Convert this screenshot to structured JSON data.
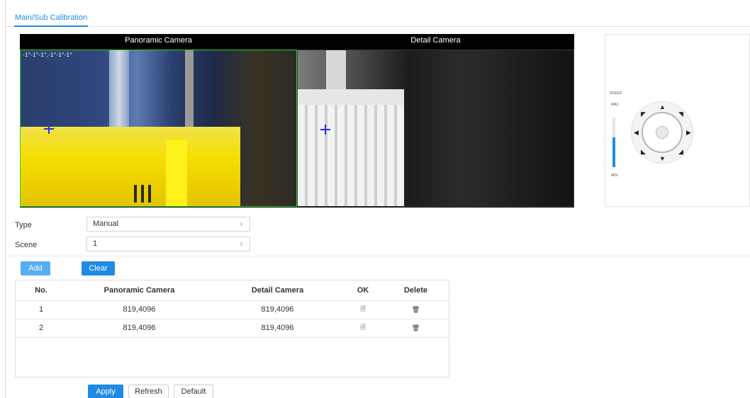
{
  "tabs": [
    {
      "label": "Main/Sub Calibration",
      "active": true
    }
  ],
  "video": {
    "panoramic_title": "Panoramic Camera",
    "detail_title": "Detail Camera",
    "osd_text": "-1°-1°-1°,-1°-1°-1°"
  },
  "ptz": {
    "speed_label": "SPEED",
    "max_label": "MAX",
    "min_label": "MIN",
    "speed_level": 0.6,
    "icons": [
      "up-arrow-icon",
      "down-arrow-icon",
      "left-arrow-icon",
      "right-arrow-icon",
      "up-left-arrow-icon",
      "up-right-arrow-icon",
      "down-left-arrow-icon",
      "down-right-arrow-icon"
    ]
  },
  "form": {
    "type_label": "Type",
    "type_value": "Manual",
    "scene_label": "Scene",
    "scene_value": "1"
  },
  "actions": {
    "add": "Add",
    "clear": "Clear"
  },
  "table": {
    "columns": [
      "No.",
      "Panoramic Camera",
      "Detail Camera",
      "OK",
      "Delete"
    ],
    "rows": [
      {
        "no": "1",
        "panoramic": "819,4096",
        "detail": "819,4096"
      },
      {
        "no": "2",
        "panoramic": "819,4096",
        "detail": "819,4096"
      }
    ]
  },
  "footer": {
    "apply": "Apply",
    "refresh": "Refresh",
    "default": "Default"
  },
  "colors": {
    "accent": "#1e8ce6",
    "selection_border": "#2fd12f",
    "calibration_point": "#2730e5"
  }
}
